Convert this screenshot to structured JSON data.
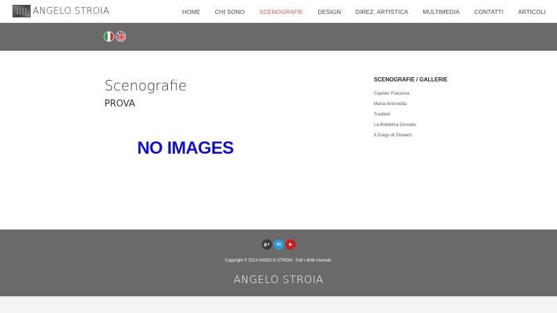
{
  "header": {
    "logo_text": "ANGELO STROIA",
    "nav": [
      {
        "label": "HOME",
        "active": false
      },
      {
        "label": "CHI SONO",
        "active": false
      },
      {
        "label": "SCENOGRAFIE",
        "active": true
      },
      {
        "label": "DESIGN",
        "active": false
      },
      {
        "label": "DIREZ. ARTISTICA",
        "active": false
      },
      {
        "label": "MULTIMEDIA",
        "active": false
      },
      {
        "label": "CONTATTI",
        "active": false
      },
      {
        "label": "ARTICOLI",
        "active": false
      }
    ],
    "active_color": "#e15a5a"
  },
  "languages": [
    {
      "icon": "italy-flag-icon"
    },
    {
      "icon": "uk-flag-icon"
    }
  ],
  "main": {
    "title": "Scenografie",
    "subtitle": "PROVA",
    "placeholder": "NO IMAGES",
    "placeholder_color": "#1010d4"
  },
  "sidebar": {
    "title": "SCENOGRAFIE / GALLERIE",
    "items": [
      "Capitan Fracassa",
      "Maria Antonietta",
      "Traditori",
      "La Bisbetica Domata",
      "Il Drago di Shwartz"
    ]
  },
  "footer": {
    "social": [
      {
        "icon": "google-plus-icon",
        "glyph": "g+"
      },
      {
        "icon": "linkedin-icon",
        "glyph": "in"
      },
      {
        "icon": "youtube-icon",
        "glyph": "▶"
      }
    ],
    "copyright": "Copyright © 2013 ANGELO STROIA. Tutti i diritti riservati.",
    "logo_text": "ANGELO STROIA"
  }
}
